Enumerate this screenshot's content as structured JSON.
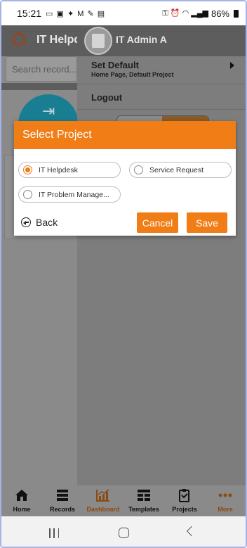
{
  "status_bar": {
    "time": "15:21",
    "battery": "86%"
  },
  "app": {
    "title": "IT Helpd",
    "search_placeholder": "Search record..."
  },
  "drawer": {
    "user_name": "IT Admin A",
    "set_default": {
      "label": "Set Default",
      "sub": "Home Page, Default Project"
    },
    "logout": "Logout"
  },
  "dialog": {
    "title": "Select Project",
    "options": [
      {
        "label": "IT Helpdesk",
        "selected": true
      },
      {
        "label": "Service Request",
        "selected": false
      },
      {
        "label": "IT Problem Manage...",
        "selected": false
      }
    ],
    "back_label": "Back",
    "cancel_label": "Cancel",
    "save_label": "Save"
  },
  "tabbar": {
    "items": [
      {
        "label": "Home",
        "icon": "home-icon"
      },
      {
        "label": "Records",
        "icon": "records-icon"
      },
      {
        "label": "Dashboard",
        "icon": "dashboard-icon",
        "active": true
      },
      {
        "label": "Templates",
        "icon": "templates-icon"
      },
      {
        "label": "Projects",
        "icon": "projects-icon"
      },
      {
        "label": "More",
        "icon": "more-icon"
      }
    ]
  },
  "colors": {
    "accent": "#f07d16",
    "teal": "#1a7e92",
    "overlay": "#8a8a8a"
  }
}
